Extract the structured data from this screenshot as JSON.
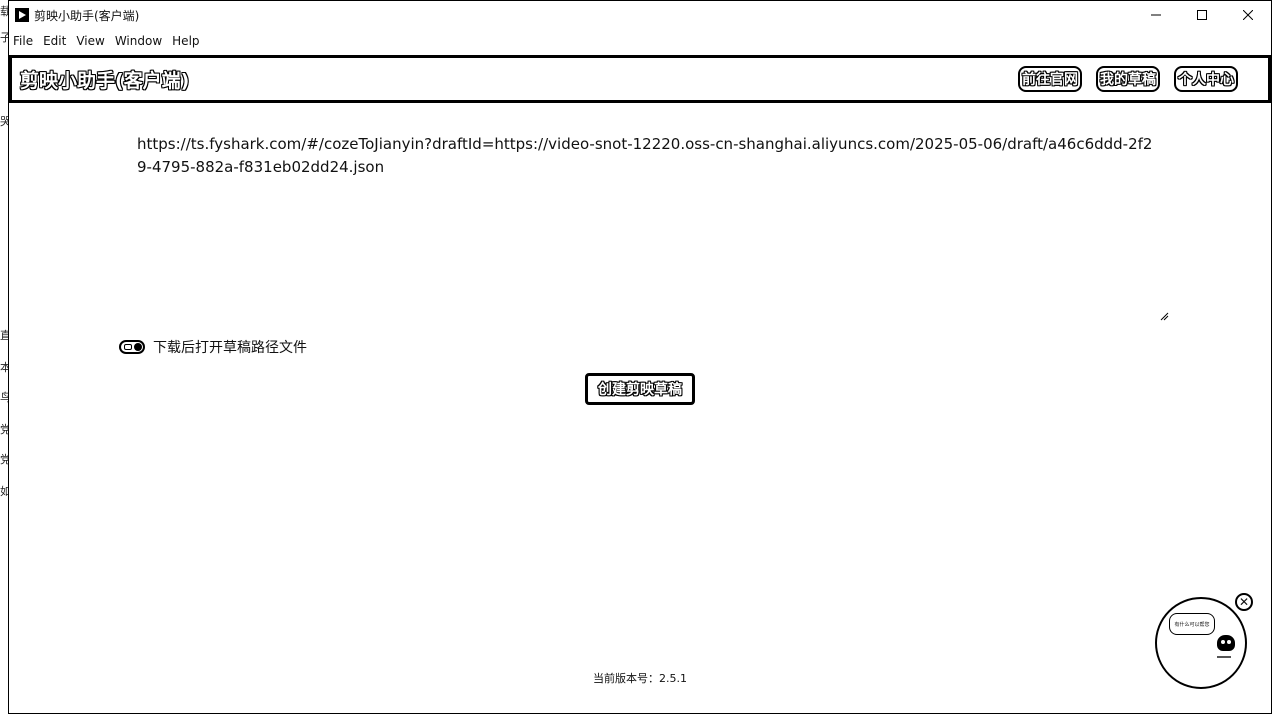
{
  "window": {
    "title": "剪映小助手(客户端)",
    "controls": {
      "minimize": "minimize",
      "maximize": "maximize",
      "close": "close"
    }
  },
  "menubar": {
    "items": [
      "File",
      "Edit",
      "View",
      "Window",
      "Help"
    ]
  },
  "header": {
    "brand": "剪映小助手(客户端)",
    "nav": [
      "前往官网",
      "我的草稿",
      "个人中心"
    ]
  },
  "main": {
    "url_text": "https://ts.fyshark.com/#/cozeToJianyin?draftId=https://video-snot-12220.oss-cn-shanghai.aliyuncs.com/2025-05-06/draft/a46c6ddd-2f29-4795-882a-f831eb02dd24.json",
    "toggle_label": "下载后打开草稿路径文件",
    "toggle_on": true,
    "create_button": "创建剪映草稿"
  },
  "footer": {
    "version": "当前版本号：2.5.1"
  },
  "assistant": {
    "bubble_text": "有什么可以帮您"
  },
  "icons": {
    "app": "app-play-icon",
    "minimize": "minimize-icon",
    "maximize": "maximize-icon",
    "close": "close-icon",
    "assistant_close": "close-circle-icon",
    "robot": "robot-icon"
  }
}
